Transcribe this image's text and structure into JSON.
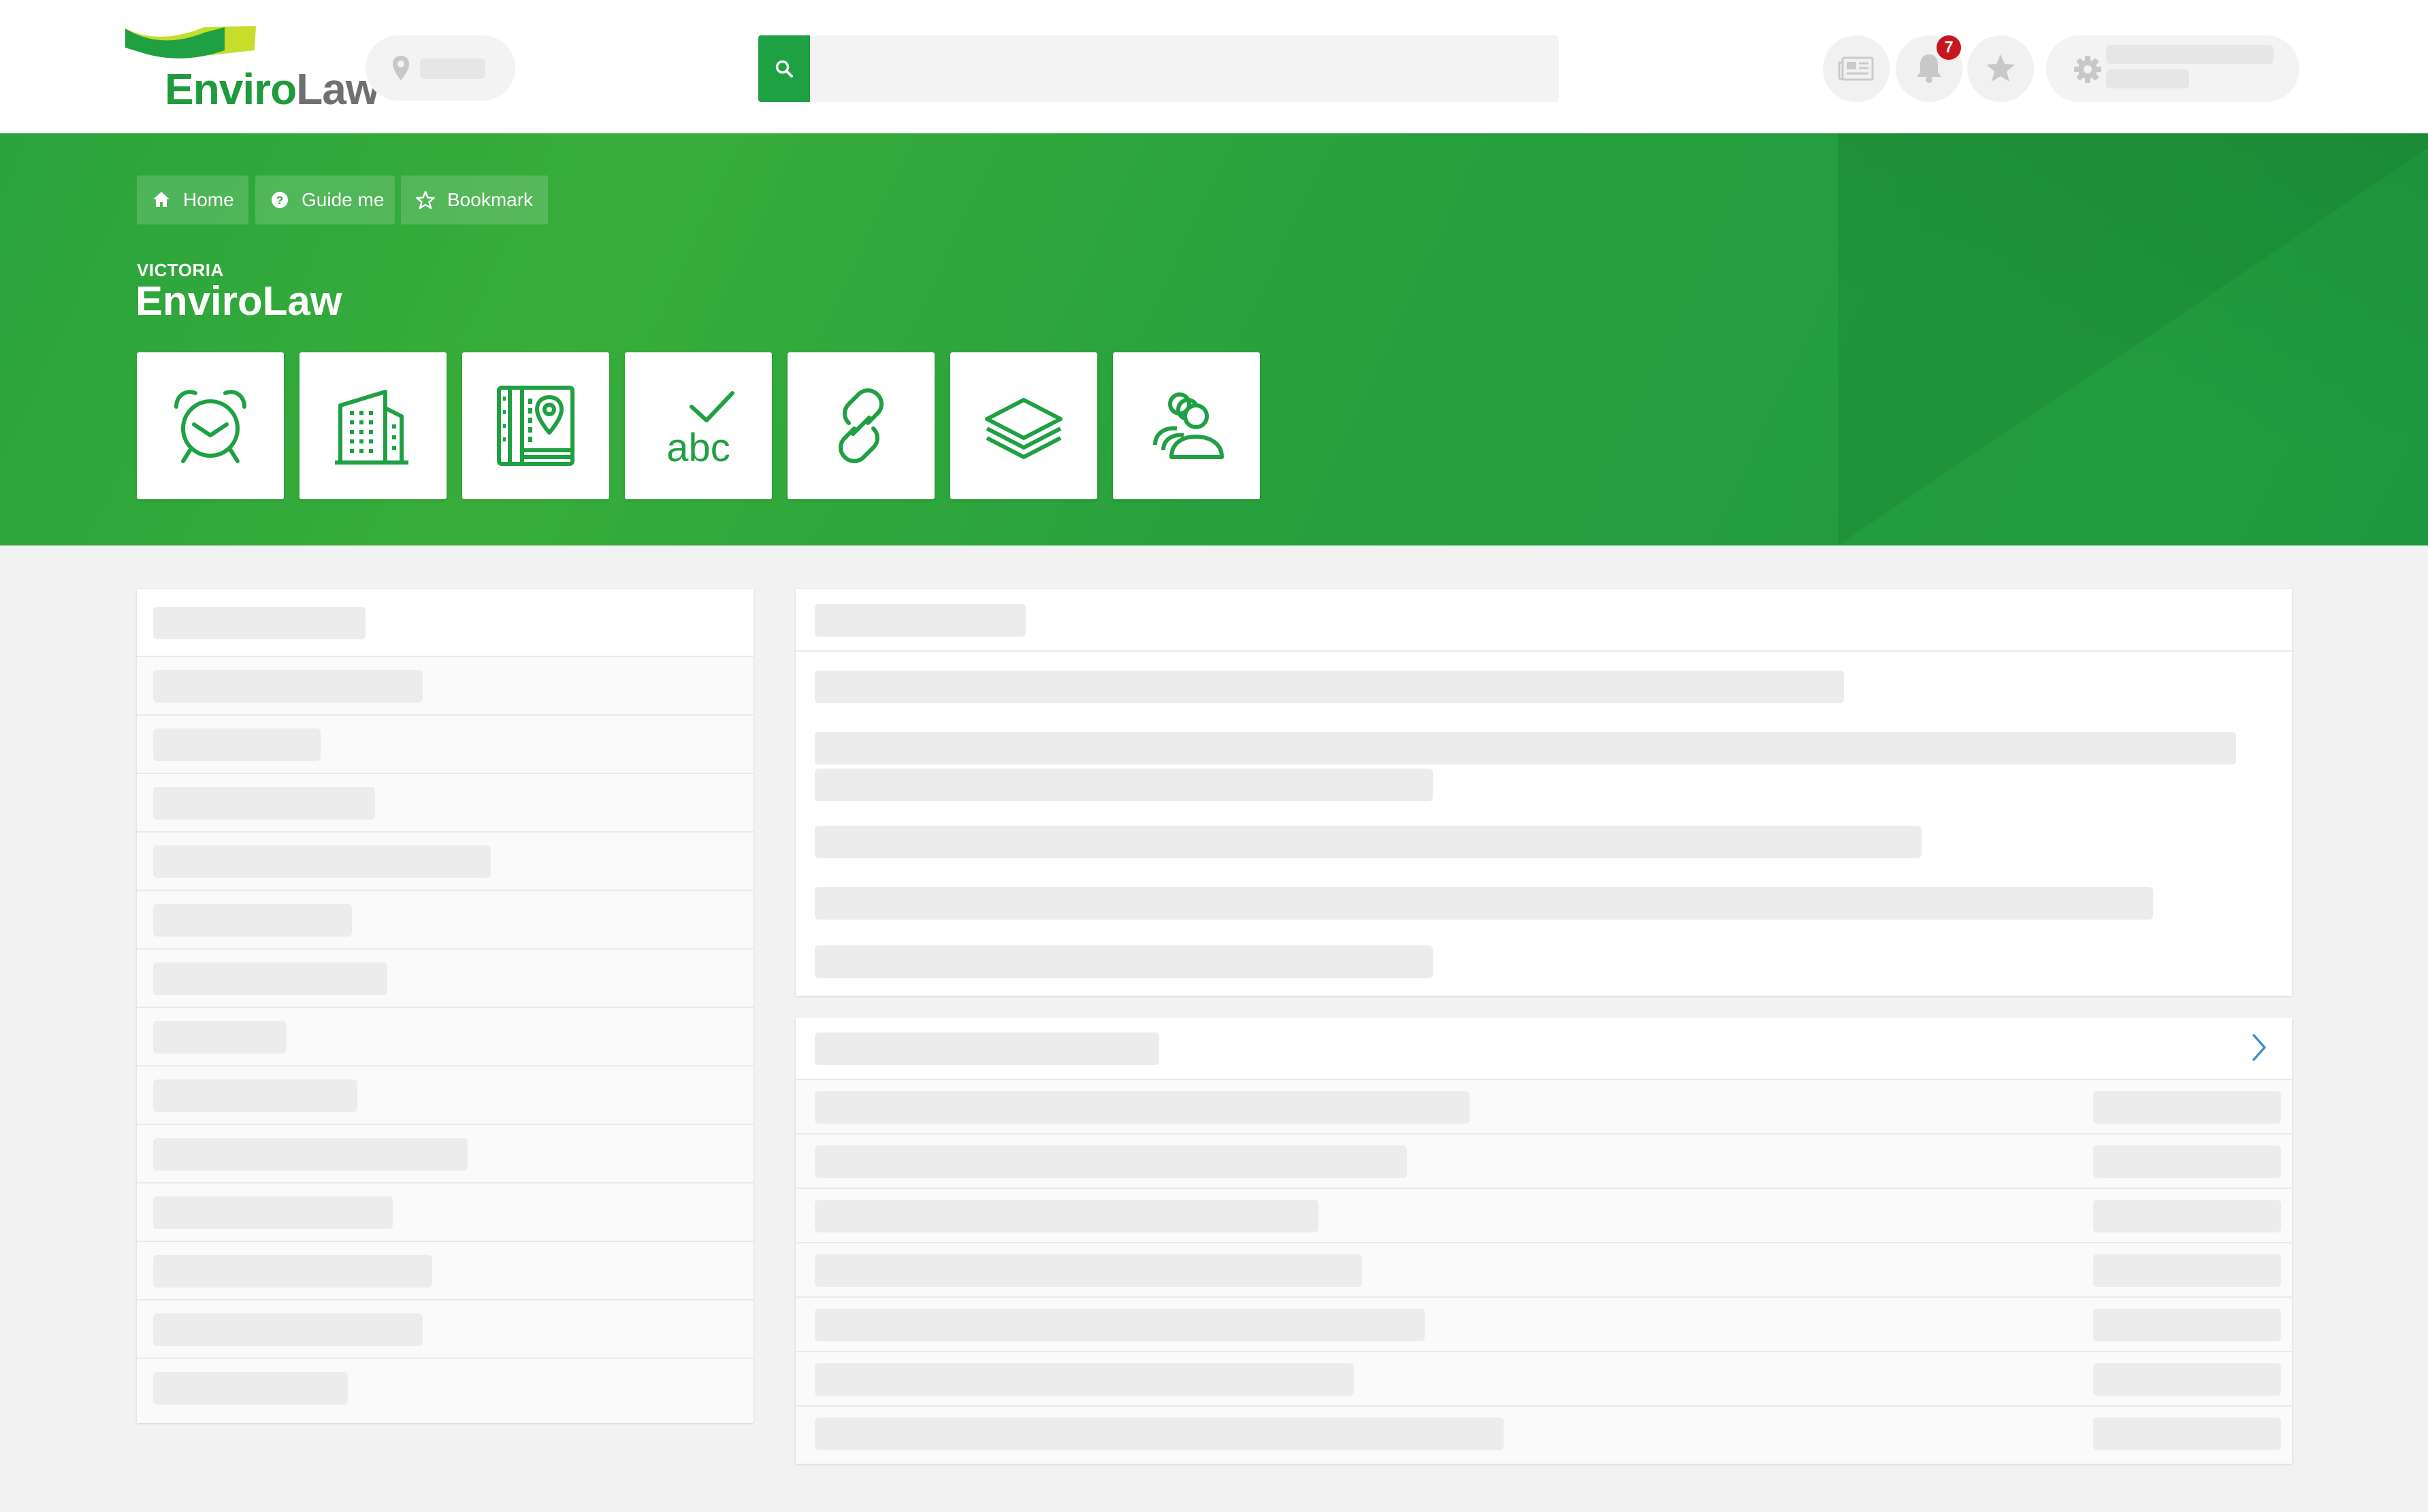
{
  "app": {
    "logo_text_primary": "Enviro",
    "logo_text_secondary": "Law",
    "brand_colors": {
      "green": "#1fa043",
      "grey": "#707070",
      "yellow": "#c7dd2c"
    }
  },
  "header": {
    "location_icon": "map-pin-icon",
    "search": {
      "icon": "search-icon",
      "placeholder": ""
    },
    "actions": [
      {
        "name": "news",
        "icon": "newspaper-icon"
      },
      {
        "name": "notifications",
        "icon": "bell-icon",
        "badge": "7"
      },
      {
        "name": "favourites",
        "icon": "star-icon"
      },
      {
        "name": "settings",
        "icon": "gear-icon"
      }
    ]
  },
  "hero": {
    "breadcrumbs": [
      {
        "label": "Home",
        "icon": "home-icon"
      },
      {
        "label": "Guide me",
        "icon": "question-circle-icon"
      },
      {
        "label": "Bookmark",
        "icon": "star-outline-icon"
      }
    ],
    "region": "VICTORIA",
    "title": "EnviroLaw",
    "tiles": [
      {
        "name": "alarm-clock",
        "icon": "alarm-clock-icon"
      },
      {
        "name": "building",
        "icon": "building-icon"
      },
      {
        "name": "map-book",
        "icon": "map-book-icon"
      },
      {
        "name": "spell-check",
        "icon": "spell-check-icon"
      },
      {
        "name": "link",
        "icon": "link-icon"
      },
      {
        "name": "layers",
        "icon": "layers-icon"
      },
      {
        "name": "people",
        "icon": "people-group-icon"
      }
    ]
  },
  "content": {
    "state": "loading",
    "next_icon": "chevron-right-icon"
  }
}
